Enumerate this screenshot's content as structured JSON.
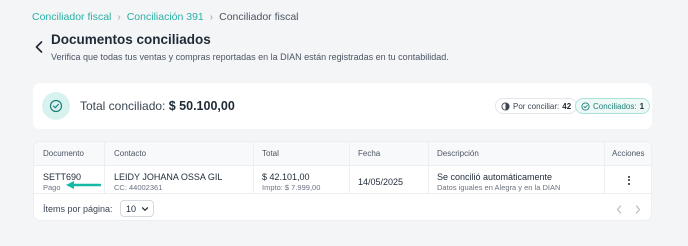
{
  "breadcrumb": {
    "items": [
      "Conciliador fiscal",
      "Conciliación 391"
    ],
    "current": "Conciliador fiscal",
    "separator": "›"
  },
  "header": {
    "title": "Documentos conciliados",
    "subtitle": "Verifica que todas tus ventas y compras reportadas en la DIAN están registradas en tu contabilidad."
  },
  "summary": {
    "label": "Total conciliado:",
    "amount": "$ 50.100,00",
    "chips": {
      "pending_label": "Por conciliar:",
      "pending_count": "42",
      "done_label": "Conciliados:",
      "done_count": "1"
    }
  },
  "table": {
    "columns": [
      "Documento",
      "Contacto",
      "Total",
      "Fecha",
      "Descripción",
      "Acciones"
    ],
    "rows": [
      {
        "documento": "SETT690",
        "documento_tipo": "Pago",
        "contacto": "LEIDY JOHANA OSSA GIL",
        "contacto_id": "CC: 44002361",
        "total": "$ 42.101,00",
        "impuesto": "Impto: $ 7.999,00",
        "fecha": "14/05/2025",
        "descripcion": "Se concilió automáticamente",
        "descripcion_detalle": "Datos iguales en Alegra y en la DIAN"
      }
    ]
  },
  "footer": {
    "page_size_label": "Ítems por página:",
    "page_size_value": "10"
  },
  "colors": {
    "accent": "#2ab0a6",
    "check_bg": "#d8f3ef",
    "chip_done_bg": "#eef9f7",
    "arrow": "#16b8a6"
  }
}
